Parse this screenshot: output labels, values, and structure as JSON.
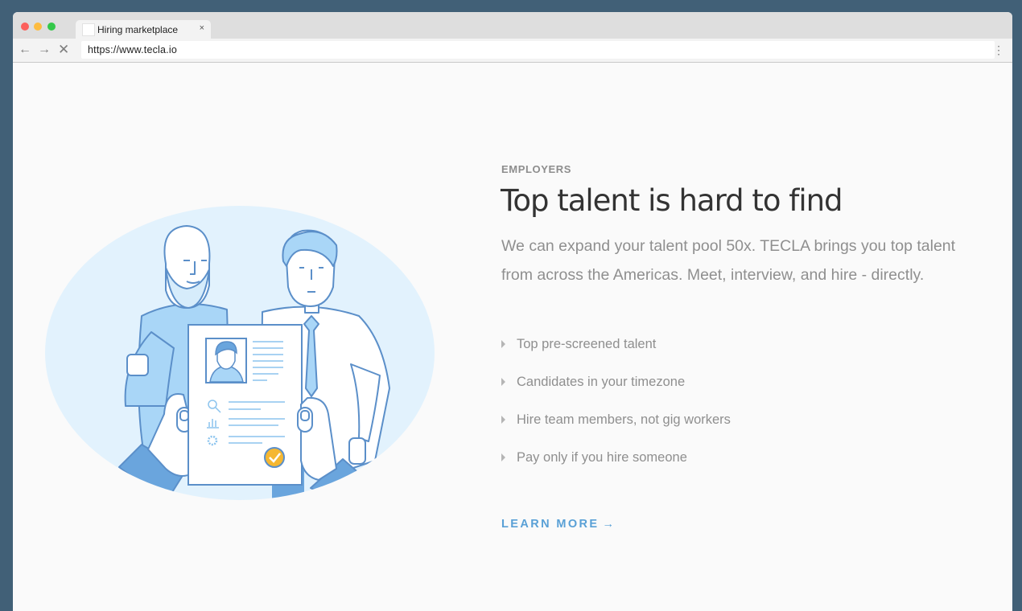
{
  "browser": {
    "tab_title": "Hiring marketplace",
    "tab_close": "×",
    "url": "https://www.tecla.io",
    "back_glyph": "←",
    "forward_glyph": "→",
    "stop_glyph": "✕",
    "menu_glyph": "⋮"
  },
  "section": {
    "eyebrow": "EMPLOYERS",
    "headline": "Top talent is hard to find",
    "description": "We can expand your talent pool 50x. TECLA brings you top talent from across the Americas. Meet, interview, and hire - directly.",
    "features": [
      "Top pre-screened talent",
      "Candidates in your timezone",
      "Hire team members, not gig workers",
      "Pay only if you hire someone"
    ],
    "cta_label": "LEARN MORE",
    "cta_arrow": "→"
  },
  "illustration": {
    "name": "two-men-holding-resume-illustration",
    "colors": {
      "ellipse": "#e2f2fd",
      "line": "#5b8fc9",
      "light_blue": "#a9d6f7",
      "badge": "#f5b731"
    }
  }
}
